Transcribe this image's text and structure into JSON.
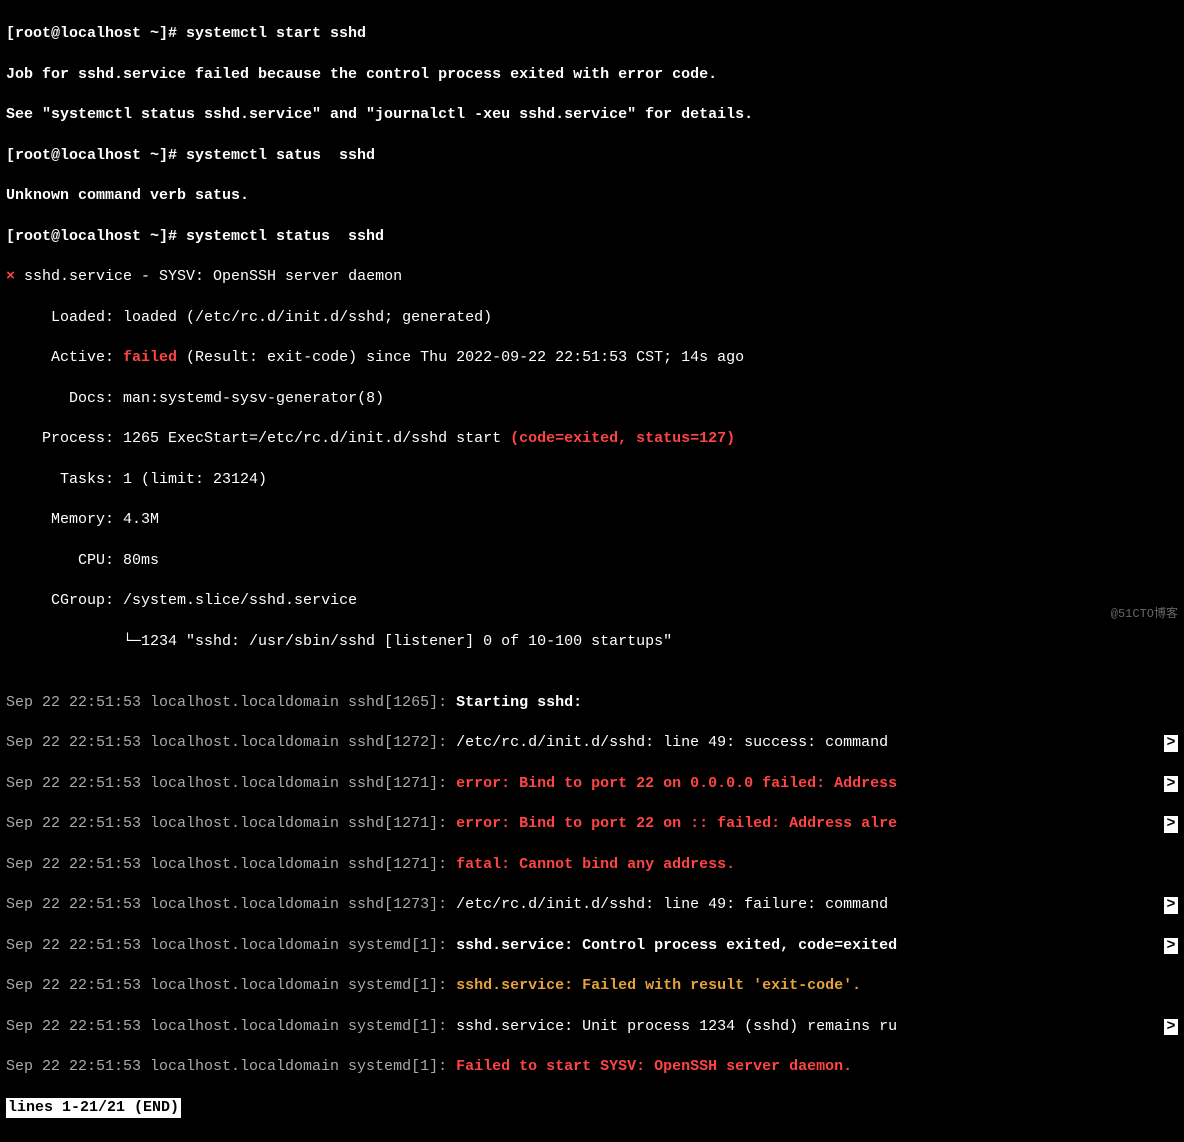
{
  "prompt1": "[root@localhost ~]# ",
  "cmd1": "systemctl start sshd",
  "job_fail": "Job for sshd.service failed because the control process exited with error code.",
  "see_details": "See \"systemctl status sshd.service\" and \"journalctl -xeu sshd.service\" for details.",
  "cmd2": "systemctl satus  sshd",
  "unknown": "Unknown command verb satus.",
  "cmd3": "systemctl status  sshd",
  "x": "×",
  "svc_header": " sshd.service - SYSV: OpenSSH server daemon",
  "lbl_loaded": "     Loaded: ",
  "val_loaded": "loaded (/etc/rc.d/init.d/sshd; generated)",
  "lbl_active": "     Active: ",
  "active_failed": "failed",
  "active_rest": " (Result: exit-code) since Thu 2022-09-22 22:51:53 CST; 14s ago",
  "lbl_docs": "       Docs: ",
  "val_docs": "man:systemd-sysv-generator(8)",
  "lbl_process": "    Process: ",
  "proc_pre": "1265 ExecStart=/etc/rc.d/init.d/sshd start ",
  "proc_code": "(code=exited, status=127)",
  "lbl_tasks": "      Tasks: ",
  "val_tasks": "1 (limit: 23124)",
  "lbl_memory": "     Memory: ",
  "val_memory": "4.3M",
  "lbl_cpu": "        CPU: ",
  "val_cpu": "80ms",
  "lbl_cgroup": "     CGroup: ",
  "val_cgroup": "/system.slice/sshd.service",
  "cgroup_tree": "             └─1234 \"sshd: /usr/sbin/sshd [listener] 0 of 10-100 startups\"",
  "blank": "",
  "log1_pre": "Sep 22 22:51:53 localhost.localdomain sshd[1265]: ",
  "log1_msg": "Starting sshd:",
  "log2_pre": "Sep 22 22:51:53 localhost.localdomain sshd[1272]: ",
  "log2_msg": "/etc/rc.d/init.d/sshd: line 49: success: command ",
  "log3_pre": "Sep 22 22:51:53 localhost.localdomain sshd[1271]: ",
  "log3_msg": "error: Bind to port 22 on 0.0.0.0 failed: Address",
  "log4_pre": "Sep 22 22:51:53 localhost.localdomain sshd[1271]: ",
  "log4_msg": "error: Bind to port 22 on :: failed: Address alre",
  "log5_pre": "Sep 22 22:51:53 localhost.localdomain sshd[1271]: ",
  "log5_msg": "fatal: Cannot bind any address.",
  "log6_pre": "Sep 22 22:51:53 localhost.localdomain sshd[1273]: ",
  "log6_msg": "/etc/rc.d/init.d/sshd: line 49: failure: command ",
  "log7_pre": "Sep 22 22:51:53 localhost.localdomain systemd[1]: ",
  "log7_msg": "sshd.service: Control process exited, code=exited",
  "log8_pre": "Sep 22 22:51:53 localhost.localdomain systemd[1]: ",
  "log8_msg": "sshd.service: Failed with result 'exit-code'.",
  "log9_pre": "Sep 22 22:51:53 localhost.localdomain systemd[1]: ",
  "log9_msg": "sshd.service: Unit process 1234 (sshd) remains ru",
  "log10_pre": "Sep 22 22:51:53 localhost.localdomain systemd[1]: ",
  "log10_msg": "Failed to start SYSV: OpenSSH server daemon.",
  "pager": "lines 1-21/21 (END)",
  "arrow": ">",
  "watermark": "@51CTO博客"
}
